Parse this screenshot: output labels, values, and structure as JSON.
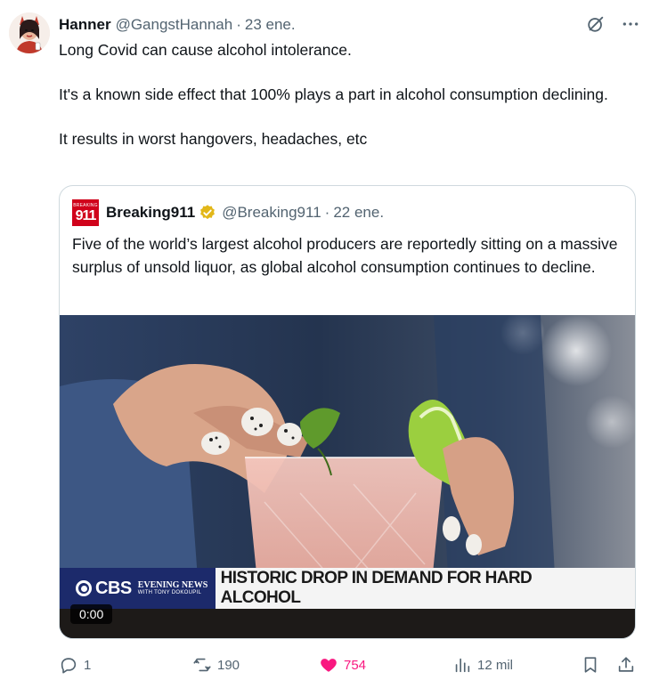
{
  "author": {
    "display_name": "Hanner",
    "handle": "@GangstHannah",
    "separator": "·",
    "timestamp": "23 ene."
  },
  "tweet": {
    "paragraphs": [
      "Long Covid can cause alcohol intolerance.",
      "It's a known side effect that 100% plays a part in alcohol consumption declining.",
      "It results in worst hangovers, headaches, etc"
    ]
  },
  "quoted": {
    "avatar_small": "BREAKING",
    "avatar_big": "911",
    "display_name": "Breaking911",
    "handle": "@Breaking911",
    "separator": "·",
    "timestamp": "22 ene.",
    "text": "Five of the world’s largest alcohol producers are reportedly sitting on a massive surplus of unsold liquor, as global alcohol consumption continues to decline.",
    "video": {
      "network": "CBS",
      "show_line1": "EVENING NEWS",
      "show_line2": "WITH TONY DOKOUPIL",
      "headline": "HISTORIC DROP IN DEMAND FOR HARD ALCOHOL",
      "duration": "0:00"
    }
  },
  "actions": {
    "replies": "1",
    "reposts": "190",
    "likes": "754",
    "views": "12 mil"
  },
  "colors": {
    "like": "#f91880",
    "muted": "#536471",
    "verified": "#e2b719",
    "breaking_red": "#d0021b",
    "cbs_blue": "#1c2a6b"
  },
  "icons": [
    "grok-icon",
    "more-icon",
    "verified-badge-icon",
    "reply-icon",
    "repost-icon",
    "like-icon",
    "views-icon",
    "bookmark-icon",
    "share-icon"
  ]
}
